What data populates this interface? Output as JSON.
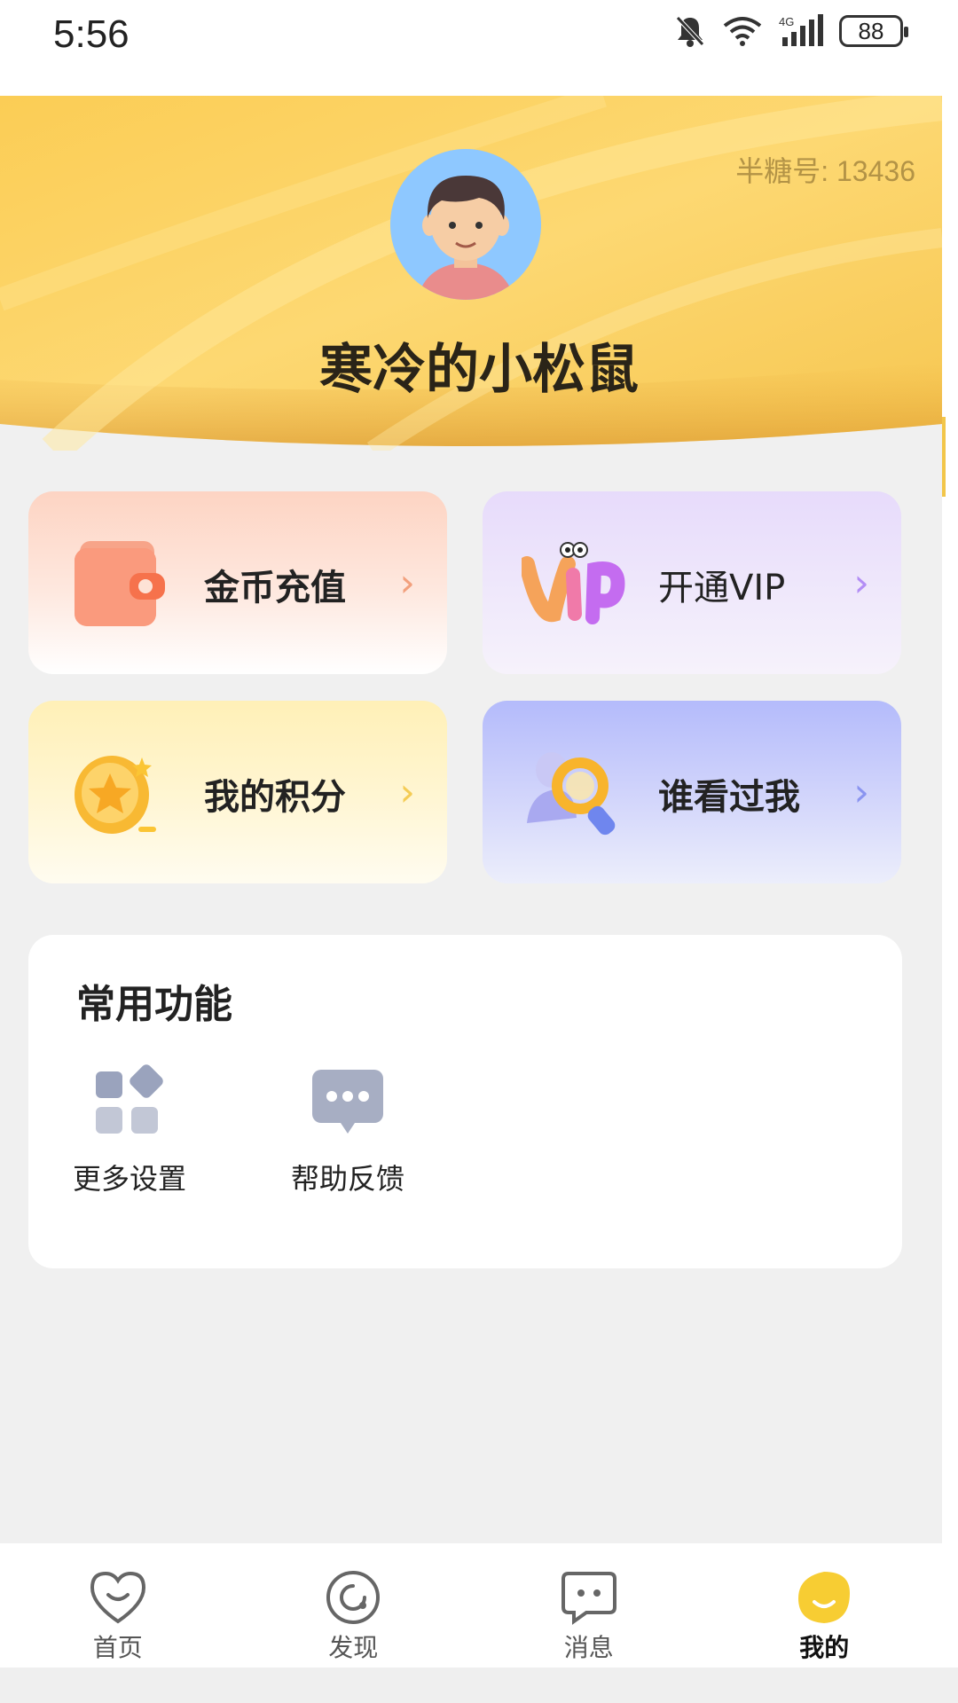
{
  "status_bar": {
    "time": "5:56",
    "network": "4G",
    "battery": "88",
    "icons": [
      "mute-icon",
      "wifi-icon",
      "signal-icon",
      "battery-icon"
    ]
  },
  "profile": {
    "id_label": "半糖号: 13436",
    "username": "寒冷的小松鼠",
    "avatar_icon": "avatar-boy"
  },
  "cards": [
    {
      "label": "金币充值",
      "icon": "wallet-icon"
    },
    {
      "label": "开通VIP",
      "icon": "vip-icon"
    },
    {
      "label": "我的积分",
      "icon": "star-coin-icon"
    },
    {
      "label": "谁看过我",
      "icon": "visitor-magnifier-icon"
    }
  ],
  "common": {
    "title": "常用功能",
    "items": [
      {
        "label": "更多设置",
        "icon": "grid-settings-icon"
      },
      {
        "label": "帮助反馈",
        "icon": "chat-bubble-icon"
      }
    ]
  },
  "tabs": [
    {
      "label": "首页",
      "icon": "heart-smile-icon",
      "active": false
    },
    {
      "label": "发现",
      "icon": "discover-icon",
      "active": false
    },
    {
      "label": "消息",
      "icon": "message-icon",
      "active": false
    },
    {
      "label": "我的",
      "icon": "me-icon",
      "active": true
    }
  ],
  "colors": {
    "accent_yellow": "#f7cd4f",
    "header_yellow": "#fbd469",
    "background": "#f0f0f0"
  }
}
